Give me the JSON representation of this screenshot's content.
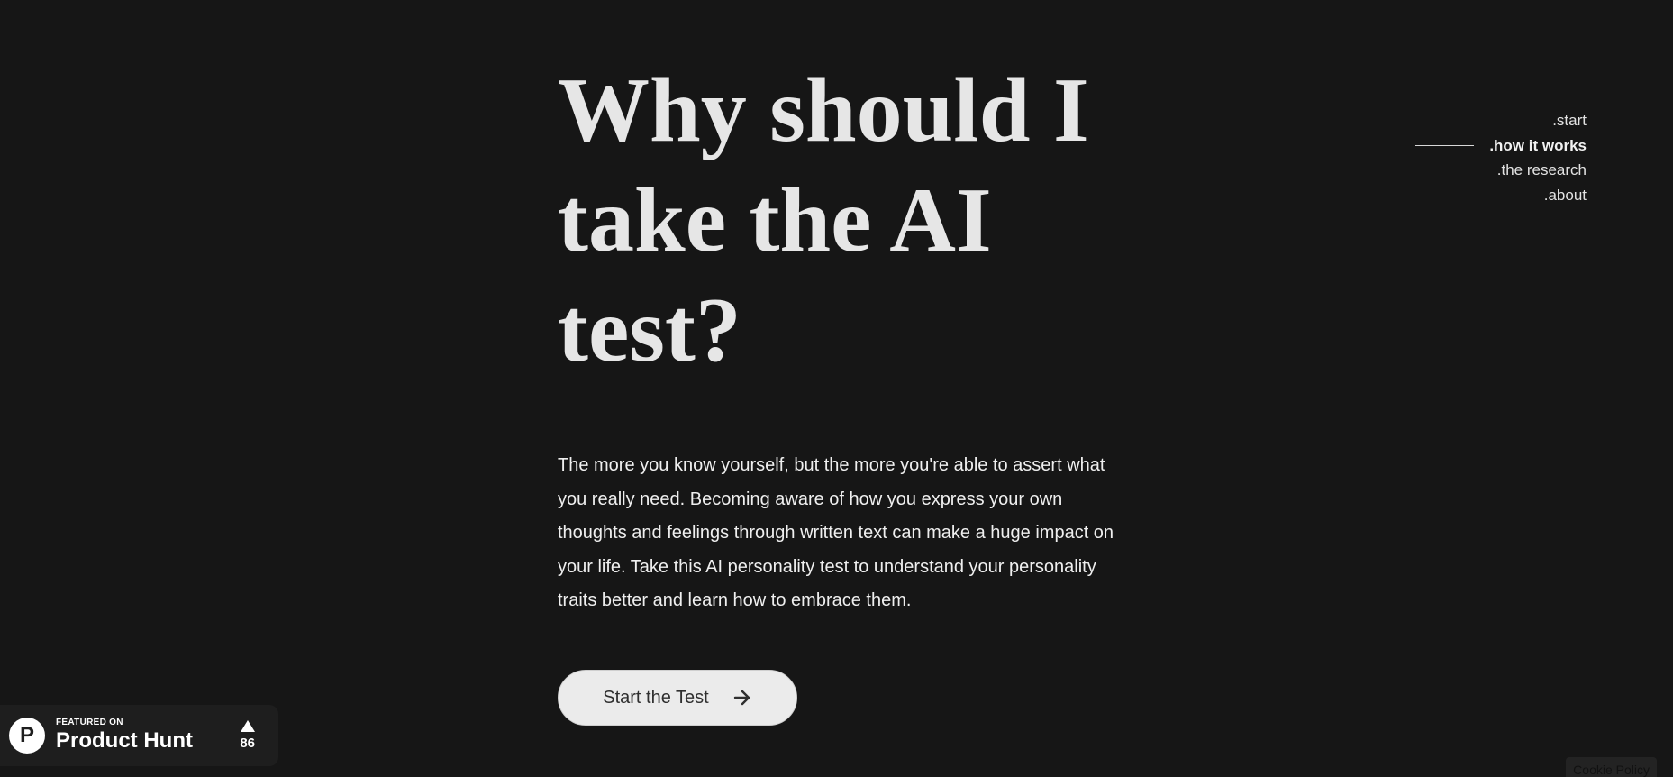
{
  "hero": {
    "title": "Why should I take the AI test?",
    "body": "The more you know yourself, but the more you're able to assert what you really need. Becoming aware of how you express your own thoughts and feelings through written text can make a huge impact on your life. Take this AI personality test to understand your personality traits better and learn how to embrace them.",
    "cta_label": "Start the Test",
    "cta_icon": "arrow-right-icon"
  },
  "nav": {
    "items": [
      {
        "label": ".start",
        "active": false
      },
      {
        "label": ".how it works",
        "active": true
      },
      {
        "label": ".the research",
        "active": false
      },
      {
        "label": ".about",
        "active": false
      }
    ]
  },
  "product_hunt": {
    "featured": "FEATURED ON",
    "name": "Product Hunt",
    "logo_letter": "P",
    "votes": "86"
  },
  "cookie": {
    "label": "Cookie Policy"
  },
  "colors": {
    "background": "#161616",
    "text": "#ececec",
    "button_bg": "#ebebeb",
    "button_text": "#2f2f2f"
  }
}
